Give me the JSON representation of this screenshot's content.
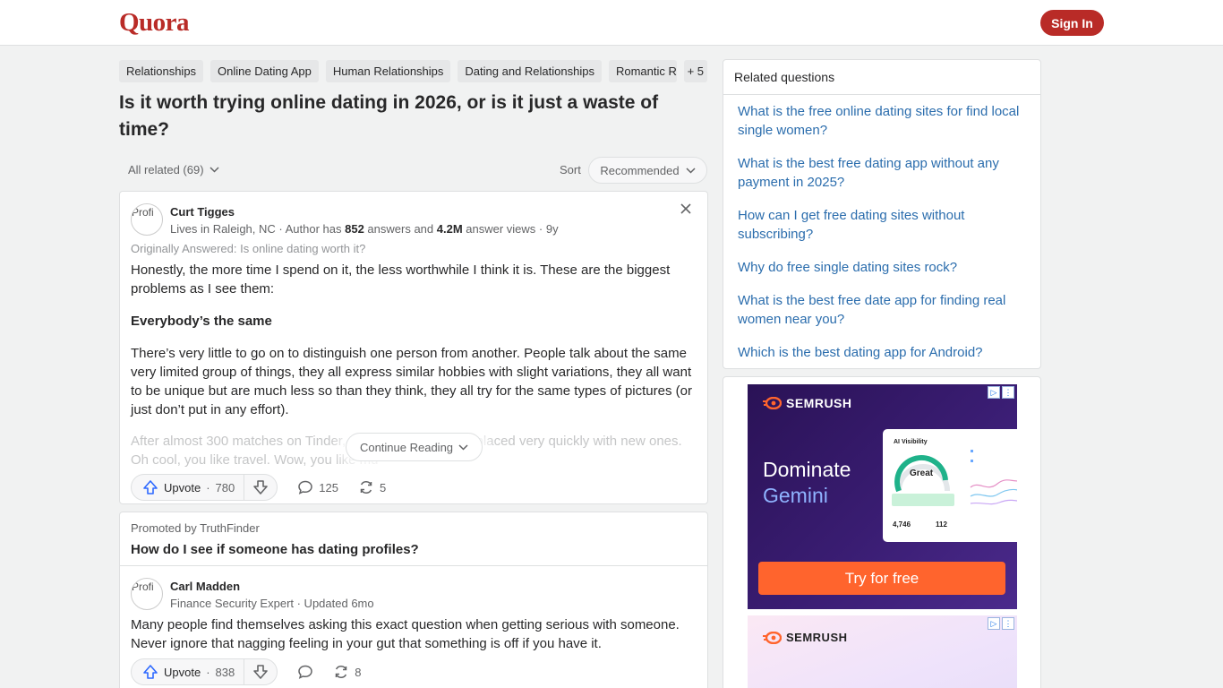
{
  "header": {
    "logo": "Quora",
    "signin_label": "Sign In"
  },
  "topics": [
    "Relationships",
    "Online Dating App",
    "Human Relationships",
    "Dating and Relationships",
    "Romantic Re",
    "+ 5"
  ],
  "question": "Is it worth trying online dating in 2026, or is it just a waste of time?",
  "filter": {
    "label": "All related (69)",
    "sort_label": "Sort",
    "sort_value": "Recommended"
  },
  "answer1": {
    "avatar_alt": "Profi",
    "author": "Curt Tigges",
    "cred_prefix": "Lives in Raleigh, NC · Author has ",
    "answers": "852",
    "cred_mid": " answers and ",
    "views": "4.2M",
    "cred_suffix": " answer views · 9y",
    "originally": "Originally Answered: Is online dating worth it?",
    "p1": "Honestly, the more time I spend on it, the less worthwhile I think it is. These are the biggest problems as I see them:",
    "h1": "Everybody’s the same",
    "p2": "There’s very little to go on to distinguish one person from another. People talk about the same very limited group of things, they all express similar hobbies with slight variations, they all want to be unique but are much less so than they think, they all try for the same types of pictures (or just don’t put in any effort).",
    "p3_faded": "After almost 300 matches on Tinder, I feel like I've been replaced very quickly with new ones. Oh cool, you like travel. Wow, you like mu",
    "continue_label": "Continue Reading",
    "upvote_label": "Upvote",
    "upvotes": "780",
    "comments": "125",
    "shares": "5"
  },
  "promoted": {
    "label": "Promoted by TruthFinder",
    "title": "How do I see if someone has dating profiles?",
    "avatar_alt": "Profi",
    "author": "Carl Madden",
    "cred": "Finance Security Expert · Updated 6mo",
    "text": "Many people find themselves asking this exact question when getting serious with someone. Never ignore that nagging feeling in your gut that something is off if you have it.",
    "upvote_label": "Upvote",
    "upvotes": "838",
    "shares": "8"
  },
  "related": {
    "title": "Related questions",
    "items": [
      "What is the free online dating sites for find local single women?",
      "What is the best free dating app without any payment in 2025?",
      "How can I get free dating sites without subscribing?",
      "Why do free single dating sites rock?",
      "What is the best free date app for finding real women near you?",
      "Which is the best dating app for Android?"
    ]
  },
  "ad": {
    "brand": "SEMRUSH",
    "headline1": "Dominate",
    "headline2": "Gemini",
    "panel_title": "AI Visibility",
    "score": "Great",
    "stat1": "4,746",
    "stat2": "112",
    "cta": "Try for free",
    "brand_color": "#ff642d"
  }
}
